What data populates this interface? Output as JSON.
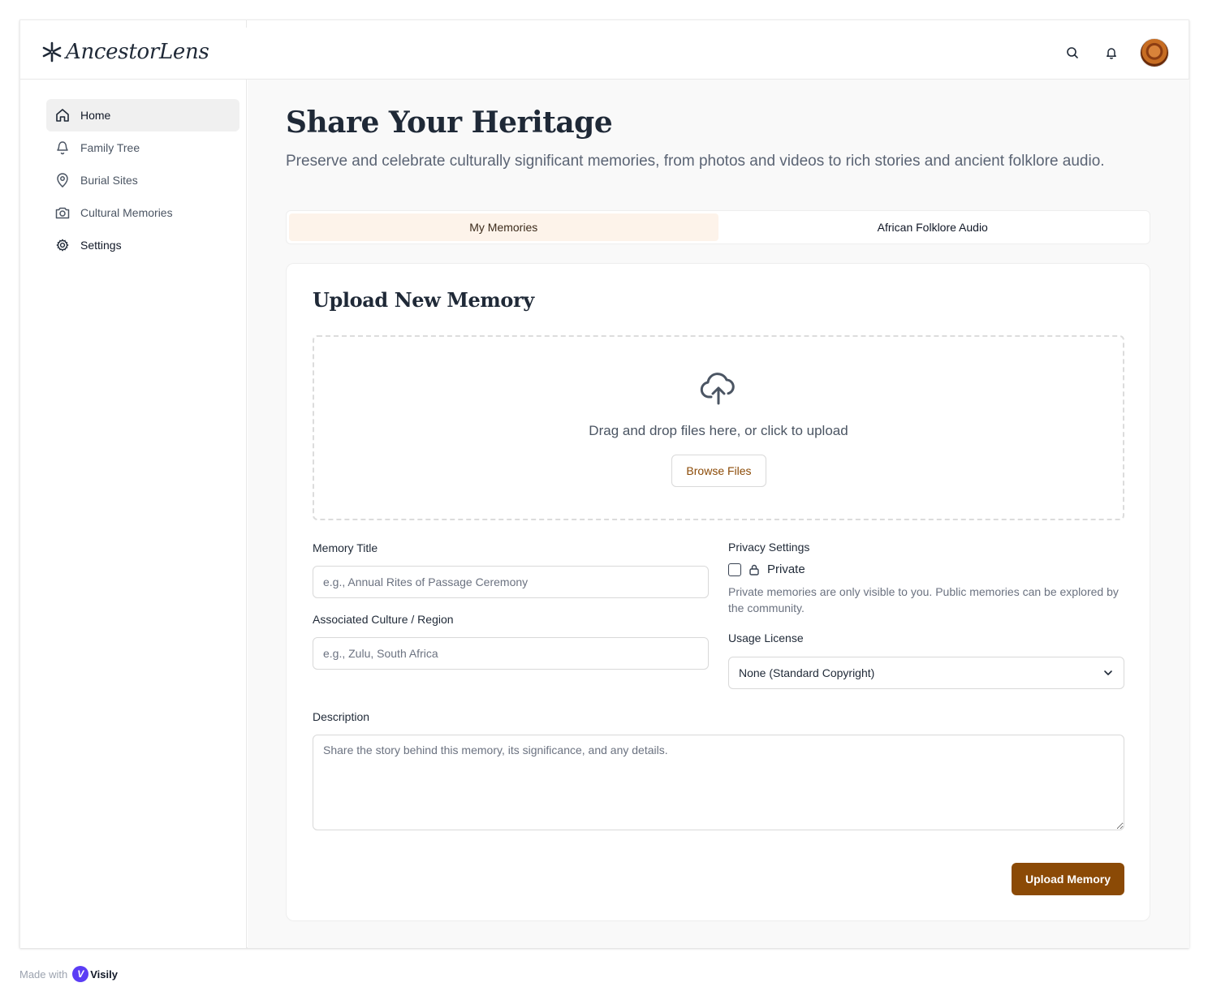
{
  "app": {
    "name": "AncestorLens"
  },
  "header": {
    "search_icon": "search-icon",
    "notification_icon": "bell-icon"
  },
  "sidebar": {
    "items": [
      {
        "label": "Home",
        "icon": "home-icon",
        "active": true
      },
      {
        "label": "Family Tree",
        "icon": "tree-icon",
        "active": false
      },
      {
        "label": "Burial Sites",
        "icon": "map-pin-icon",
        "active": false
      },
      {
        "label": "Cultural Memories",
        "icon": "camera-icon",
        "active": false
      },
      {
        "label": "Settings",
        "icon": "gear-icon",
        "active": false
      }
    ]
  },
  "main": {
    "title": "Share Your Heritage",
    "subtitle": "Preserve and celebrate culturally significant memories, from photos and videos to rich stories and ancient folklore audio.",
    "tabs": [
      {
        "label": "My Memories",
        "active": true
      },
      {
        "label": "African Folklore Audio",
        "active": false
      }
    ]
  },
  "upload_card": {
    "title": "Upload New Memory",
    "dropzone_text": "Drag and drop files here, or click to upload",
    "browse_label": "Browse Files",
    "memory_title_label": "Memory Title",
    "memory_title_placeholder": "e.g., Annual Rites of Passage Ceremony",
    "culture_label": "Associated Culture / Region",
    "culture_placeholder": "e.g., Zulu, South Africa",
    "privacy_label": "Privacy Settings",
    "private_label": "Private",
    "private_checked": false,
    "privacy_help": "Private memories are only visible to you. Public memories can be explored by the community.",
    "license_label": "Usage License",
    "license_value": "None (Standard Copyright)",
    "description_label": "Description",
    "description_placeholder": "Share the story behind this memory, its significance, and any details.",
    "submit_label": "Upload Memory"
  },
  "footer": {
    "made_with": "Made with",
    "brand": "Visily"
  },
  "colors": {
    "accent": "#8b4a06",
    "tab_active_bg": "#fdf3ea",
    "page_bg": "#f9f9f9"
  }
}
